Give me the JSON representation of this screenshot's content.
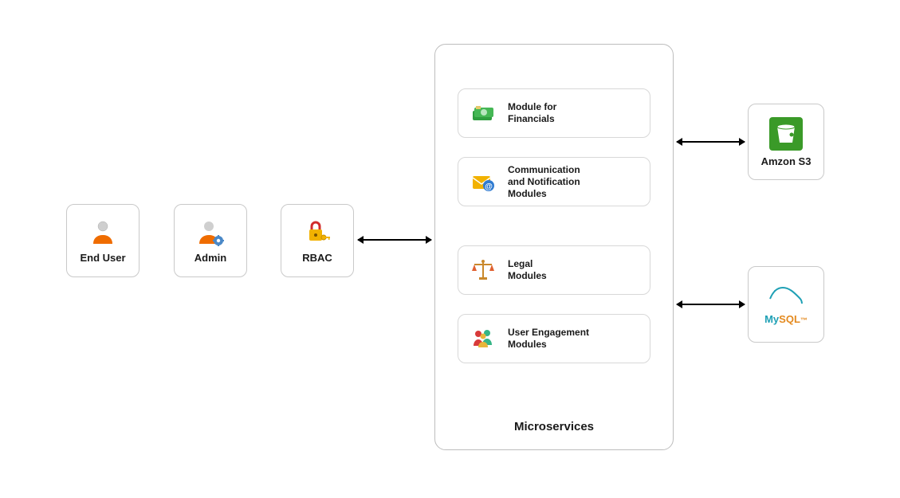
{
  "actors": {
    "end_user": {
      "label": "End User"
    },
    "admin": {
      "label": "Admin"
    }
  },
  "rbac": {
    "label": "RBAC"
  },
  "microservices": {
    "title": "Microservices",
    "modules": [
      {
        "label": "Module for\nFinancials",
        "icon": "money-stack-icon"
      },
      {
        "label": "Communication\nand Notification\nModules",
        "icon": "mail-at-icon"
      },
      {
        "label": "Legal\nModules",
        "icon": "scales-icon"
      },
      {
        "label": "User Engagement\nModules",
        "icon": "people-group-icon"
      }
    ]
  },
  "storage": {
    "s3": {
      "label": "Amzon S3"
    },
    "mysql": {
      "label": "MySQL"
    }
  }
}
